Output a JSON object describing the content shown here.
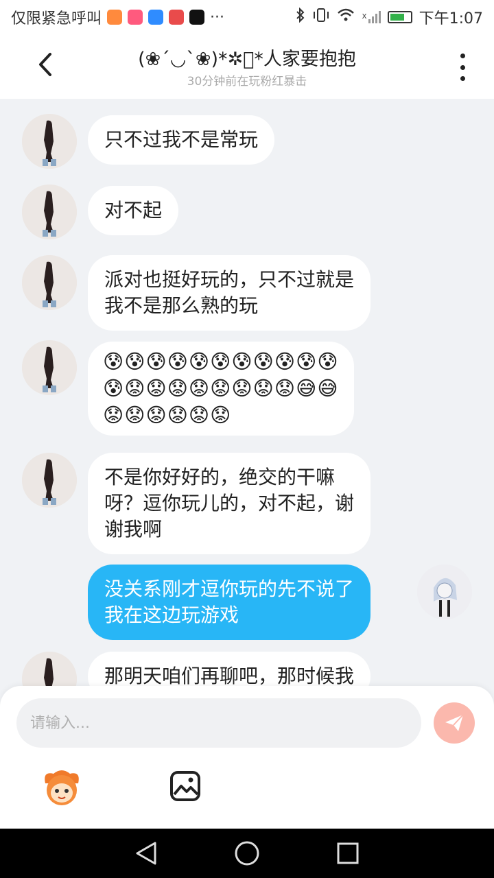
{
  "status_bar": {
    "left_text": "仅限紧急呼叫",
    "more": "···",
    "time": "下午1:07",
    "wifi_badge": "x",
    "app_icons": [
      {
        "name": "app-icon-orange",
        "color": "#ff8a3d"
      },
      {
        "name": "app-icon-pink",
        "color": "#ff5a7e"
      },
      {
        "name": "app-icon-blue",
        "color": "#2f8cff"
      },
      {
        "name": "app-icon-red",
        "color": "#e94b4b"
      },
      {
        "name": "tiktok-icon",
        "color": "#111111"
      }
    ]
  },
  "header": {
    "title": "(❀´◡`❀)*✲ﾟ*人家要抱抱",
    "subtitle": "30分钟前在玩粉红暴击",
    "back_icon": "chevron-left-icon",
    "more_icon": "more-vertical-icon"
  },
  "messages": [
    {
      "from": "them",
      "text": "只不过我不是常玩"
    },
    {
      "from": "them",
      "text": "对不起"
    },
    {
      "from": "them",
      "lines": [
        "派对也挺好玩的，只不过就是",
        "我不是那么熟的玩"
      ]
    },
    {
      "from": "them",
      "emoji": true,
      "lines": [
        "😰😰😰😰😰😰😰😰😰😰😰",
        "😰😟😟😟😟😟😟😟😟😅😅",
        "😟😟😟😟😟😟"
      ]
    },
    {
      "from": "them",
      "lines": [
        "不是你好好的，绝交的干嘛",
        "呀？逗你玩儿的，对不起，谢",
        "谢我啊"
      ]
    },
    {
      "from": "me",
      "lines": [
        "没关系刚才逗你玩的先不说了",
        "我在这边玩游戏"
      ]
    },
    {
      "from": "them",
      "text": "那明天咱们再聊吧，那时候我"
    }
  ],
  "composer": {
    "placeholder": "请输入...",
    "send_icon": "send-icon",
    "tool_icons": [
      "mascot-face-icon",
      "image-icon"
    ]
  },
  "colors": {
    "accent_blue": "#28b6f6",
    "send_pink": "#fbb8ad",
    "bg": "#f0f2f5"
  },
  "nav_icons": [
    "back-triangle-icon",
    "home-circle-icon",
    "recents-square-icon"
  ]
}
